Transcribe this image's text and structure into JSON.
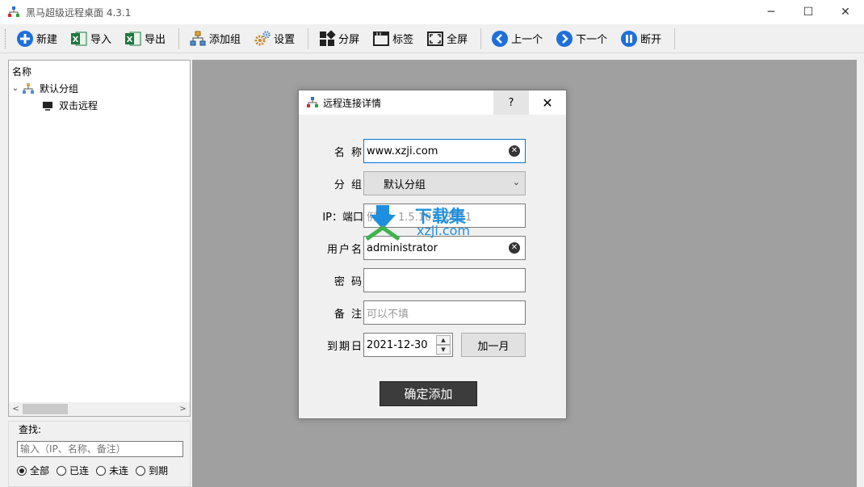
{
  "window": {
    "title": "黑马超级远程桌面 4.3.1",
    "minimize": "─",
    "maximize": "☐",
    "close": "✕"
  },
  "toolbar": {
    "new": "新建",
    "import": "导入",
    "export": "导出",
    "add_group": "添加组",
    "settings": "设置",
    "split_screen": "分屏",
    "tabs": "标签",
    "fullscreen": "全屏",
    "prev": "上一个",
    "next": "下一个",
    "disconnect": "断开"
  },
  "tree": {
    "header": "名称",
    "group": "默认分组",
    "item": "双击远程"
  },
  "search": {
    "label": "查找:",
    "placeholder": "输入（IP、名称、备注）",
    "filters": [
      {
        "label": "全部",
        "selected": true
      },
      {
        "label": "已连",
        "selected": false
      },
      {
        "label": "未连",
        "selected": false
      },
      {
        "label": "到期",
        "selected": false
      }
    ]
  },
  "dialog": {
    "title": "远程连接详情",
    "help": "?",
    "close": "✕",
    "fields": {
      "name_label": "名 称",
      "name_value": "www.xzji.com",
      "group_label": "分 组",
      "group_value": "默认分组",
      "ip_label": "IP：端口",
      "ip_placeholder": "例如：1.5.10.1:3311",
      "user_label": "用户名",
      "user_value": "administrator",
      "password_label": "密 码",
      "password_value": "",
      "note_label": "备 注",
      "note_placeholder": "可以不填",
      "expiry_label": "到期日",
      "expiry_value": "2021-12-30",
      "add_month": "加一月"
    },
    "confirm": "确定添加"
  },
  "watermark": {
    "text_cn": "下载集",
    "text_url": "xzji.com"
  },
  "colors": {
    "accent_blue": "#0078d7",
    "main_bg": "#a0a0a0",
    "confirm_bg": "#3c3c3c",
    "icon_blue": "#1e6fd9",
    "excel_green": "#1d7a3e"
  }
}
